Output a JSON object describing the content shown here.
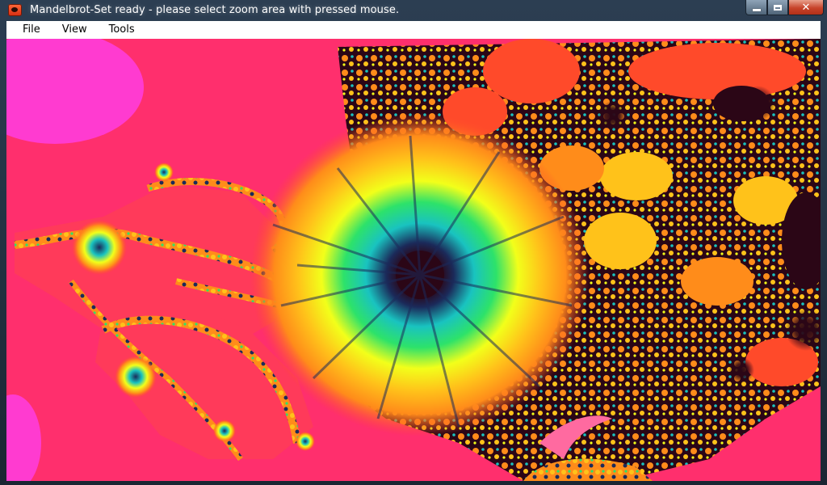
{
  "window": {
    "title": "Mandelbrot-Set ready - please select zoom area with pressed mouse.",
    "controls": {
      "minimize": "minimize-icon",
      "maximize": "maximize-icon",
      "close": "close-icon"
    }
  },
  "menu": {
    "items": [
      {
        "label": "File"
      },
      {
        "label": "View"
      },
      {
        "label": "Tools"
      }
    ]
  },
  "fractal": {
    "palette": [
      "#ff2f6d",
      "#ff3bd0",
      "#ff4a2a",
      "#ff8c1a",
      "#ffc21a",
      "#f2ff1a",
      "#2de26a",
      "#19c3c0",
      "#1b2a5a",
      "#2b0616"
    ]
  }
}
